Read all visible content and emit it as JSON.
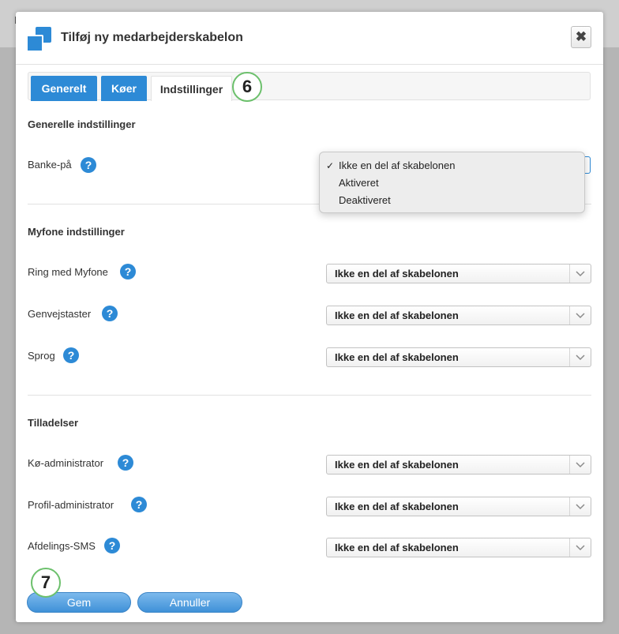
{
  "background": {
    "text": "I"
  },
  "dialog": {
    "title": "Tilføj ny medarbejderskabelon",
    "close_label": "✖"
  },
  "tabs": [
    {
      "label": "Generelt",
      "active": false
    },
    {
      "label": "Køer",
      "active": false
    },
    {
      "label": "Indstillinger",
      "active": true
    }
  ],
  "markers": {
    "tabs_step": "6",
    "save_step": "7"
  },
  "sections": {
    "general": {
      "title": "Generelle indstillinger",
      "rows": [
        {
          "label": "Banke-på",
          "value": "Ikke en del af skabelonen"
        }
      ]
    },
    "myfone": {
      "title": "Myfone indstillinger",
      "rows": [
        {
          "label": "Ring med Myfone",
          "value": "Ikke en del af skabelonen"
        },
        {
          "label": "Genvejstaster",
          "value": "Ikke en del af skabelonen"
        },
        {
          "label": "Sprog",
          "value": "Ikke en del af skabelonen"
        }
      ]
    },
    "permissions": {
      "title": "Tilladelser",
      "rows": [
        {
          "label": "Kø-administrator",
          "value": "Ikke en del af skabelonen"
        },
        {
          "label": "Profil-administrator",
          "value": "Ikke en del af skabelonen"
        },
        {
          "label": "Afdelings-SMS",
          "value": "Ikke en del af skabelonen"
        }
      ]
    }
  },
  "dropdown_options": [
    {
      "label": "Ikke en del af skabelonen",
      "selected": true
    },
    {
      "label": "Aktiveret",
      "selected": false
    },
    {
      "label": "Deaktiveret",
      "selected": false
    }
  ],
  "help_symbol": "?",
  "check_symbol": "✓",
  "buttons": {
    "save": "Gem",
    "cancel": "Annuller"
  },
  "colors": {
    "accent": "#2d8ad6",
    "step_border": "#6cc06c"
  },
  "icons": {
    "logo": "app-logo-icon",
    "help": "help-icon",
    "close": "close-icon",
    "chevron": "chevron-down-icon"
  }
}
